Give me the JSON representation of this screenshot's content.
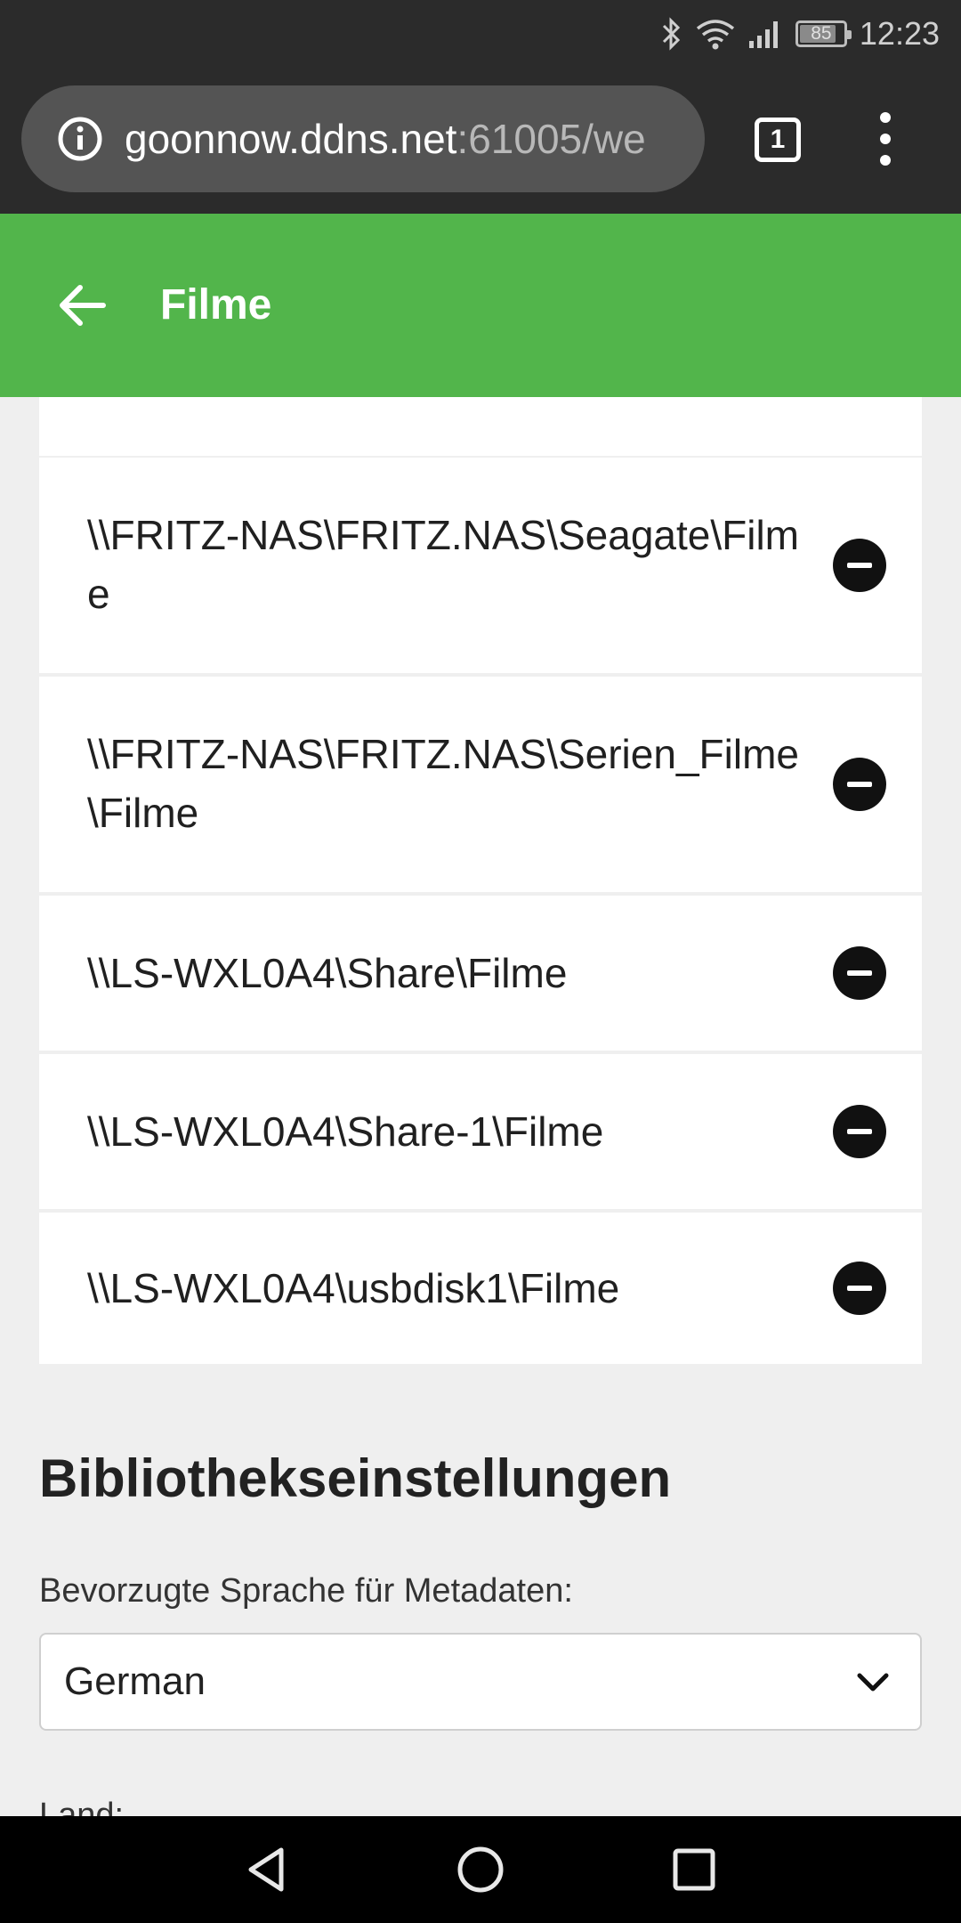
{
  "status_bar": {
    "time": "12:23",
    "battery": "85",
    "battery_level": 0.85,
    "icons": [
      "bluetooth-icon",
      "wifi-icon",
      "cell-signal-icon",
      "battery-icon"
    ]
  },
  "browser": {
    "url_host": "goonnow.ddns.net",
    "url_rest": ":61005/we",
    "tab_count": "1",
    "icons": [
      "info-icon",
      "tabs-icon",
      "overflow-menu-icon"
    ]
  },
  "header": {
    "title": "Filme",
    "background": "#52b54b",
    "back_icon": "back-arrow-icon"
  },
  "folders": [
    {
      "path": "\\\\FRITZ-NAS\\FRITZ.NAS\\Seagate\\Filme"
    },
    {
      "path": "\\\\FRITZ-NAS\\FRITZ.NAS\\Serien_Filme\\Filme"
    },
    {
      "path": "\\\\LS-WXL0A4\\Share\\Filme"
    },
    {
      "path": "\\\\LS-WXL0A4\\Share-1\\Filme"
    },
    {
      "path": "\\\\LS-WXL0A4\\usbdisk1\\Filme"
    }
  ],
  "settings": {
    "section_title": "Bibliothekseinstellungen",
    "language_label": "Bevorzugte Sprache für Metadaten:",
    "language_value": "German",
    "next_label": "Land:"
  },
  "nav": {
    "icons": [
      "nav-back-icon",
      "nav-home-icon",
      "nav-recents-icon"
    ]
  }
}
